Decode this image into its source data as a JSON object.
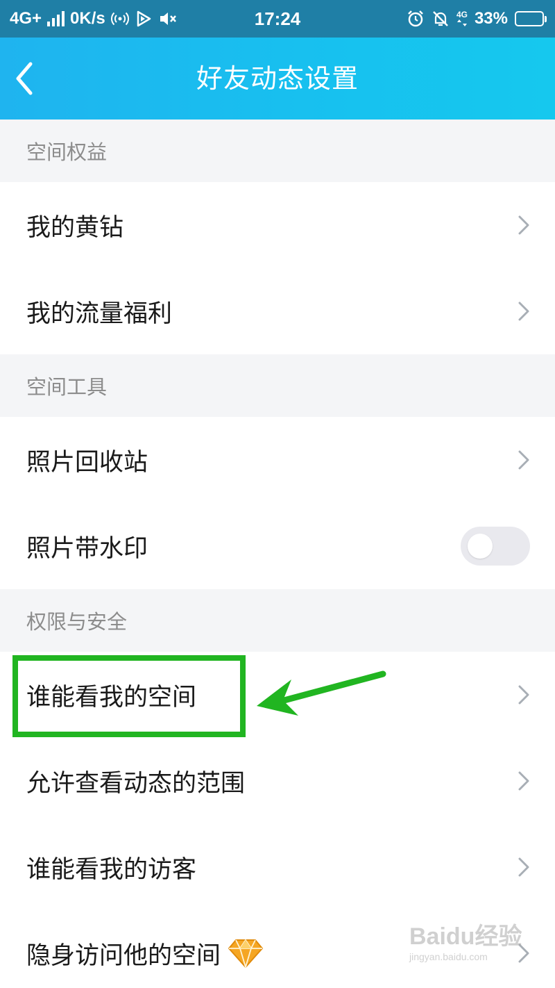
{
  "status_bar": {
    "network": "4G+",
    "speed": "0K/s",
    "time": "17:24",
    "mini_network": "4G",
    "battery_percent": "33%",
    "battery_level": 0.33
  },
  "nav": {
    "title": "好友动态设置"
  },
  "sections": [
    {
      "header": "空间权益",
      "rows": [
        {
          "label": "我的黄钻"
        },
        {
          "label": "我的流量福利"
        }
      ]
    },
    {
      "header": "空间工具",
      "rows": [
        {
          "label": "照片回收站"
        },
        {
          "label": "照片带水印",
          "toggle": false
        }
      ]
    },
    {
      "header": "权限与安全",
      "rows": [
        {
          "label": "谁能看我的空间"
        },
        {
          "label": "允许查看动态的范围"
        },
        {
          "label": "谁能看我的访客"
        },
        {
          "label": "隐身访问他的空间"
        }
      ]
    }
  ],
  "colors": {
    "header_gradient_start": "#1fb4ef",
    "header_gradient_end": "#16c8ee",
    "highlight": "#21b521",
    "gem": "#f5a623"
  },
  "watermark": {
    "brand": "Baidu经验",
    "url": "jingyan.baidu.com"
  }
}
